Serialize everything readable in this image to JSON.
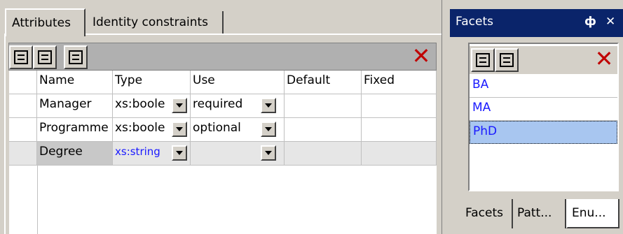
{
  "left_tabs": [
    {
      "label": "Attributes",
      "active": true
    },
    {
      "label": "Identity constraints",
      "active": false
    }
  ],
  "attributes_toolbar": {
    "icons": [
      "append-row-icon",
      "insert-row-icon",
      "sort-icon"
    ],
    "delete_icon": "delete-x-icon"
  },
  "grid": {
    "columns": [
      "Name",
      "Type",
      "Use",
      "Default",
      "Fixed"
    ],
    "rows": [
      {
        "name": "Manager",
        "type": "xs:boole",
        "use": "required",
        "default": "",
        "fixed": ""
      },
      {
        "name": "Programme",
        "type": "xs:boole",
        "use": "optional",
        "default": "",
        "fixed": ""
      },
      {
        "name": "Degree",
        "type": "xs:string",
        "use": "",
        "default": "",
        "fixed": "",
        "selected": true
      }
    ]
  },
  "facets_panel": {
    "title": "Facets",
    "pin_glyph": "ф",
    "close_glyph": "✕",
    "items": [
      {
        "label": "BA",
        "selected": false
      },
      {
        "label": "MA",
        "selected": false
      },
      {
        "label": "PhD",
        "selected": true
      }
    ],
    "bottom_tabs": [
      {
        "label": "Facets",
        "active": false
      },
      {
        "label": "Patt...",
        "active": false
      },
      {
        "label": "Enu...",
        "active": true
      }
    ]
  },
  "colors": {
    "titlebar": "#0a246a",
    "enum_text": "#1a1aff",
    "selection": "#a8c6f0",
    "delete": "#c00000"
  }
}
